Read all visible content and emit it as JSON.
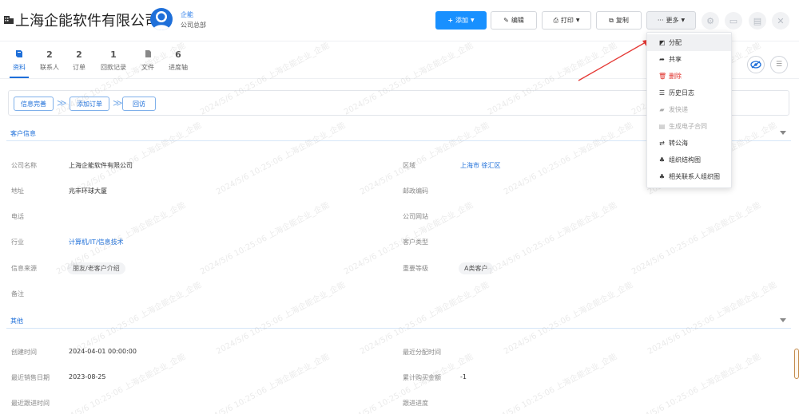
{
  "header": {
    "company_name": "上海企能软件有限公司",
    "owner_name": "企能",
    "owner_dept": "公司总部",
    "buttons": {
      "add": "添加",
      "edit": "编辑",
      "print": "打印",
      "copy": "复制",
      "more": "更多"
    },
    "accent": "#1890ff"
  },
  "tabs": [
    {
      "count": "",
      "label": "资料",
      "icon": "book-icon",
      "active": true
    },
    {
      "count": "2",
      "label": "联系人"
    },
    {
      "count": "2",
      "label": "订单"
    },
    {
      "count": "1",
      "label": "回款记录"
    },
    {
      "count": "",
      "label": "文件",
      "icon": "file-icon"
    },
    {
      "count": "6",
      "label": "进度轴"
    }
  ],
  "flow": {
    "steps": [
      "信息完善",
      "添加订单",
      "回访"
    ]
  },
  "sections": {
    "customer_info": "客户信息",
    "other": "其他"
  },
  "fields": {
    "company_name": {
      "label": "公司名称",
      "value": "上海企能软件有限公司"
    },
    "region": {
      "label": "区域",
      "value": "上海市 徐汇区"
    },
    "address": {
      "label": "地址",
      "value": "兆丰环球大厦"
    },
    "postcode": {
      "label": "邮政编码",
      "value": ""
    },
    "phone": {
      "label": "电话",
      "value": ""
    },
    "website": {
      "label": "公司网站",
      "value": ""
    },
    "industry": {
      "label": "行业",
      "value": "计算机/IT/信息技术"
    },
    "customer_type": {
      "label": "客户类型",
      "value": ""
    },
    "source": {
      "label": "信息来源",
      "value": "朋友/老客户介绍"
    },
    "importance": {
      "label": "重要等级",
      "value": "A类客户"
    },
    "remark": {
      "label": "备注",
      "value": ""
    },
    "created_time": {
      "label": "创建时间",
      "value": "2024-04-01 00:00:00"
    },
    "last_assign_time": {
      "label": "最近分配时间",
      "value": ""
    },
    "last_sale_date": {
      "label": "最近销售日期",
      "value": "2023-08-25"
    },
    "total_purchase": {
      "label": "累计购买金额",
      "value": "-1"
    },
    "last_follow_time": {
      "label": "最近跟进时间",
      "value": ""
    },
    "follow_progress": {
      "label": "跟进进度",
      "value": ""
    }
  },
  "more_menu": [
    {
      "label": "分配",
      "icon": "assign-icon",
      "state": "hover"
    },
    {
      "label": "共享",
      "icon": "share-icon",
      "state": "normal"
    },
    {
      "label": "删除",
      "icon": "trash-icon",
      "state": "danger"
    },
    {
      "label": "历史日志",
      "icon": "list-icon",
      "state": "normal"
    },
    {
      "label": "发快递",
      "icon": "truck-icon",
      "state": "disabled"
    },
    {
      "label": "生成电子合同",
      "icon": "contract-icon",
      "state": "disabled"
    },
    {
      "label": "转公海",
      "icon": "transfer-icon",
      "state": "normal"
    },
    {
      "label": "组织结构图",
      "icon": "org-chart-icon",
      "state": "normal"
    },
    {
      "label": "相关联系人组织图",
      "icon": "org-chart-icon",
      "state": "normal"
    }
  ],
  "watermark": "2024/5/6 10:25:06 上海企能企业_企能",
  "colors": {
    "link": "#1e6fd9",
    "danger": "#e0312b",
    "arrow": "#e53935"
  }
}
